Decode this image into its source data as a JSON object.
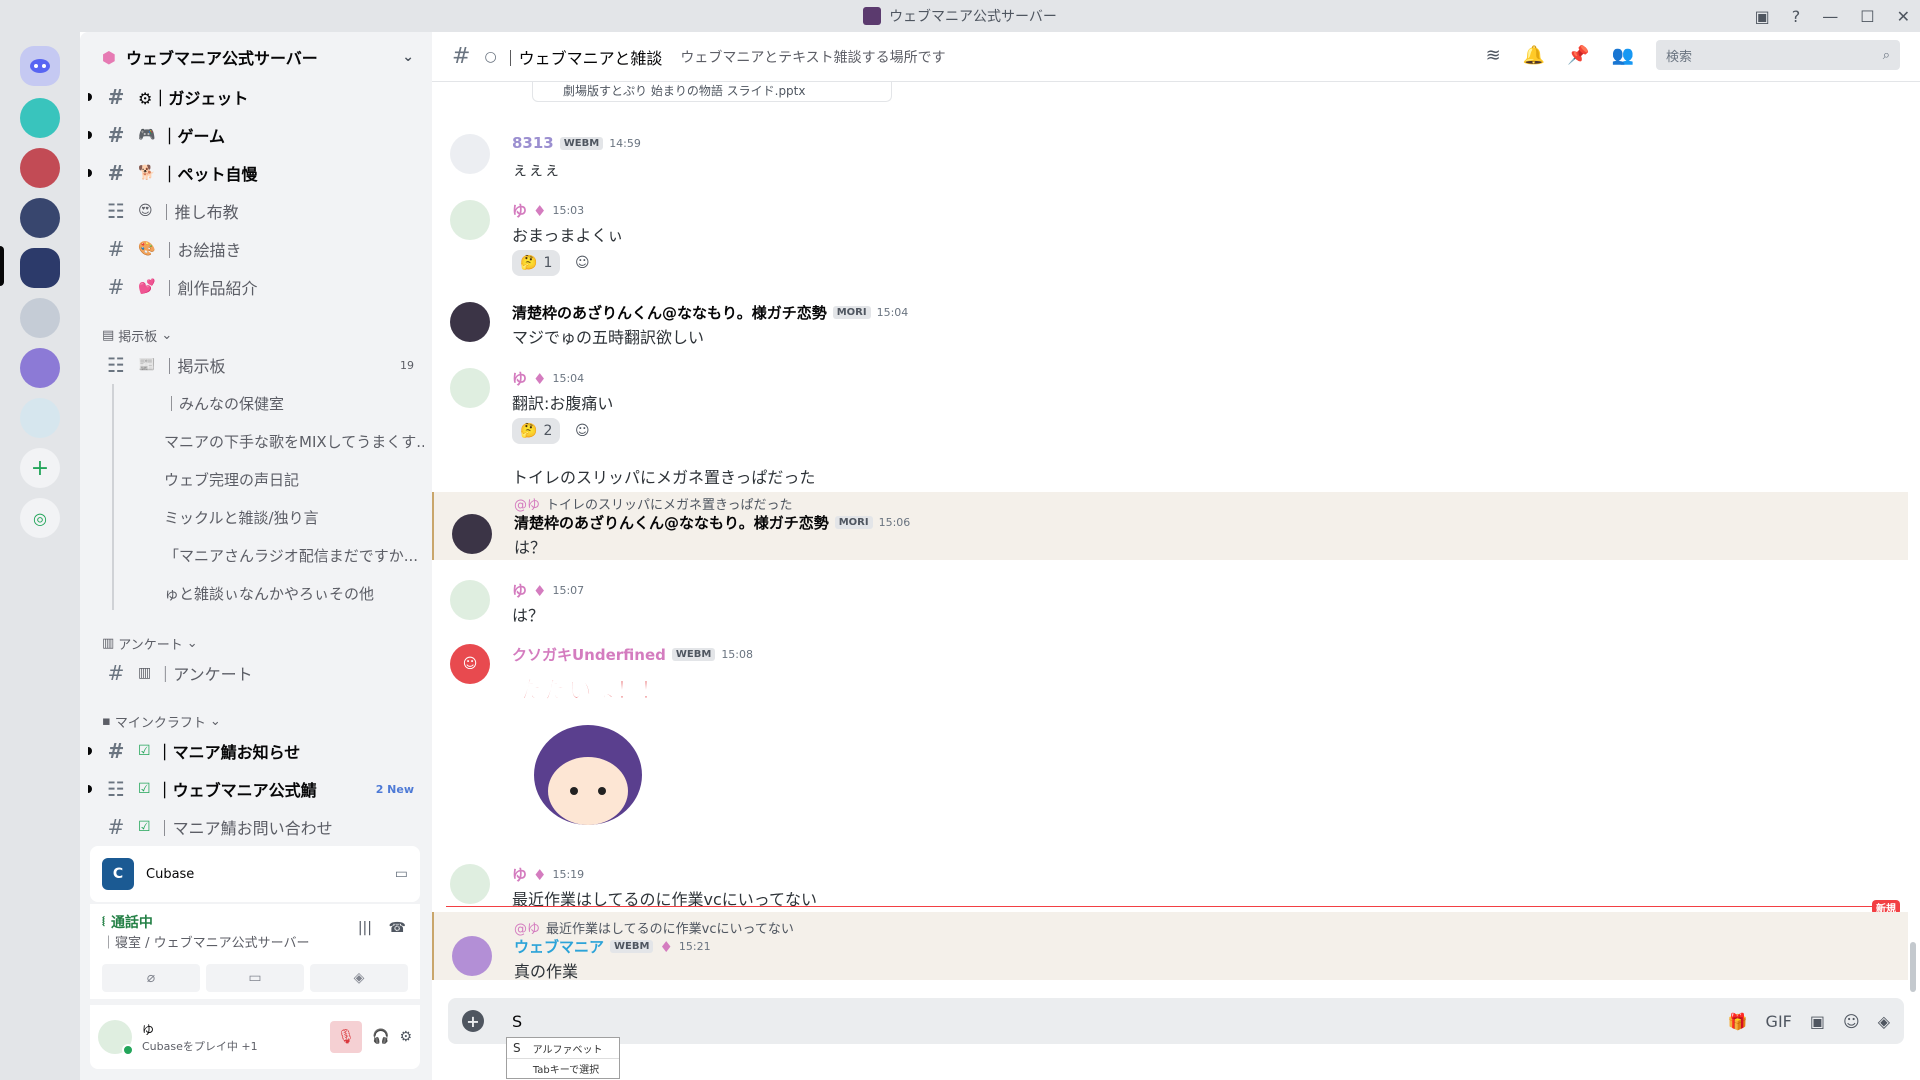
{
  "window": {
    "title": "ウェブマニア公式サーバー"
  },
  "server": {
    "name": "ウェブマニア公式サーバー"
  },
  "channels_top": [
    {
      "name": "⚙｜ガジェット",
      "bold": true
    },
    {
      "name": "｜ゲーム",
      "bold": true,
      "emoji": "🎮"
    },
    {
      "name": "｜ペット自慢",
      "bold": true,
      "emoji": "🐕"
    },
    {
      "name": "｜推し布教",
      "emoji": "😍"
    },
    {
      "name": "｜お絵描き",
      "emoji": "🎨"
    },
    {
      "name": "｜創作品紹介",
      "emoji": "💕"
    }
  ],
  "cat_board": "掲示板",
  "board_channel": {
    "name": "｜掲示板",
    "count": "19",
    "emoji": "📰"
  },
  "threads": [
    "｜みんなの保健室",
    "マニアの下手な歌をMIXしてうまくす...",
    "ウェブ完理の声日記",
    "ミックルと雑談/独り言",
    "「マニアさんラジオ配信まだですか...",
    "ゅと雑談ぃなんかやろぃその他"
  ],
  "cat_poll": "アンケート",
  "poll_channel": "｜アンケート",
  "cat_mc": "マインクラフト",
  "mc_channels": [
    {
      "name": "｜マニア鯖お知らせ",
      "bold": true
    },
    {
      "name": "｜ウェブマニア公式鯖",
      "bold": true,
      "new": "2 New"
    },
    {
      "name": "｜マニア鯖お問い合わせ"
    }
  ],
  "activity": {
    "app": "Cubase"
  },
  "voice": {
    "status": "通話中",
    "location": "｜寝室 / ウェブマニア公式サーバー"
  },
  "user": {
    "name": "ゆ",
    "status": "Cubaseをプレイ中 +1"
  },
  "channel": {
    "name": "｜ウェブマニアと雑談",
    "topic": "ウェブマニアとテキスト雑談する場所です"
  },
  "search": {
    "placeholder": "検索"
  },
  "attachment": "劇場版すとぷり 始まりの物語 スライド.pptx",
  "messages": [
    {
      "user": "8313",
      "badge": "WEBM",
      "time": "14:59",
      "text": "ぇぇぇ"
    },
    {
      "user": "ゆ",
      "time": "15:03",
      "text": "おまっまよくぃ",
      "react": "1"
    },
    {
      "user": "清楚枠のあざりんくん@ななもり。様ガチ恋勢",
      "badge": "MORI",
      "time": "15:04",
      "text": "マジでゅの五時翻訳欲しい"
    },
    {
      "user": "ゆ",
      "time": "15:04",
      "text": "翻訳:お腹痛い",
      "react": "2",
      "text2": "トイレのスリッパにメガネ置きっぱだった"
    },
    {
      "reply": "トイレのスリッパにメガネ置きっぱだった",
      "reply_at": "@ゆ",
      "user": "清楚枠のあざりんくん@ななもり。様ガチ恋勢",
      "badge": "MORI",
      "time": "15:06",
      "text": "は？"
    },
    {
      "user": "ゆ",
      "time": "15:07",
      "text": "は？"
    },
    {
      "user": "クソガキUnderfined",
      "badge": "WEBM",
      "time": "15:08",
      "sticker": "ただいま！！"
    },
    {
      "user": "ゆ",
      "time": "15:19",
      "text": "最近作業はしてるのに作業vcにいってない"
    },
    {
      "reply": "最近作業はしてるのに作業vcにいってない",
      "reply_at": "@ゆ",
      "user": "ウェブマニア",
      "badge": "WEBM",
      "time": "15:21",
      "text": "真の作業"
    }
  ],
  "new_label": "新規",
  "composer": {
    "text": "S"
  },
  "ime": {
    "candidate": "S",
    "candidate_label": "アルファベット",
    "hint": "Tabキーで選択"
  },
  "colors": {
    "accent": "#5865f2",
    "mention": "#d47cbf",
    "new": "#f23f43"
  }
}
